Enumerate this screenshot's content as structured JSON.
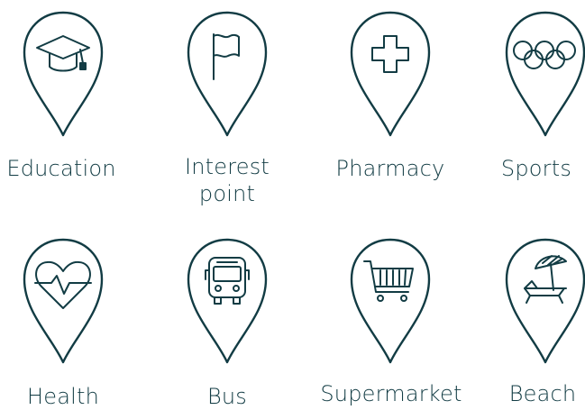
{
  "colors": {
    "stroke": "#123c44",
    "background": "#ffffff"
  },
  "icons": [
    {
      "label": "Education",
      "icon": "graduation-cap-icon"
    },
    {
      "label": "Interest\npoint",
      "icon": "flag-icon"
    },
    {
      "label": "Pharmacy",
      "icon": "cross-icon"
    },
    {
      "label": "Sports",
      "icon": "olympic-rings-icon"
    },
    {
      "label": "Health",
      "icon": "heart-pulse-icon"
    },
    {
      "label": "Bus",
      "icon": "bus-icon"
    },
    {
      "label": "Supermarket",
      "icon": "shopping-cart-icon"
    },
    {
      "label": "Beach",
      "icon": "beach-umbrella-icon"
    }
  ]
}
